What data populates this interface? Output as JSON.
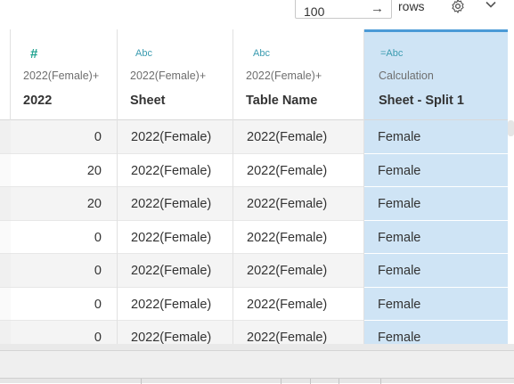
{
  "toolbar": {
    "rows_value": "100",
    "rows_label": "rows",
    "arrow_glyph": "→",
    "settings_icon": "gear-icon",
    "menu_icon": "chevron-down-icon"
  },
  "columns": [
    {
      "type_icon": "#",
      "source": "2022(Female)+",
      "name": "2022"
    },
    {
      "type_icon": "Abc",
      "source": "2022(Female)+",
      "name": "Sheet"
    },
    {
      "type_icon": "Abc",
      "source": "2022(Female)+",
      "name": "Table Name"
    },
    {
      "type_icon": "=Abc",
      "source": "Calculation",
      "name": "Sheet - Split 1"
    }
  ],
  "rows": [
    [
      "0",
      "2022(Female)",
      "2022(Female)",
      "Female"
    ],
    [
      "20",
      "2022(Female)",
      "2022(Female)",
      "Female"
    ],
    [
      "20",
      "2022(Female)",
      "2022(Female)",
      "Female"
    ],
    [
      "0",
      "2022(Female)",
      "2022(Female)",
      "Female"
    ],
    [
      "0",
      "2022(Female)",
      "2022(Female)",
      "Female"
    ],
    [
      "0",
      "2022(Female)",
      "2022(Female)",
      "Female"
    ],
    [
      "0",
      "2022(Female)",
      "2022(Female)",
      "Female"
    ]
  ],
  "colors": {
    "selected_column": "#cfe4f5",
    "selected_border": "#4b9ad6",
    "number_icon": "#1ea28f",
    "string_icon": "#3a9bb0"
  }
}
